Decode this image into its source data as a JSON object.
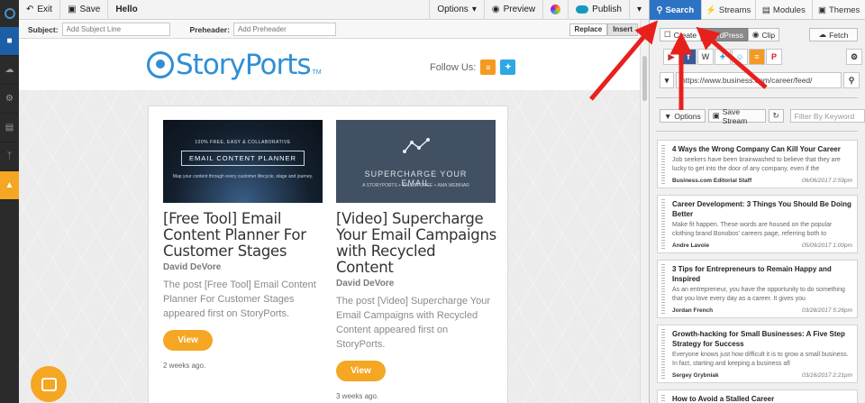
{
  "toolbar": {
    "exit": "Exit",
    "save": "Save",
    "title": "Hello",
    "options": "Options",
    "preview": "Preview",
    "publish": "Publish"
  },
  "subject": {
    "subject_label": "Subject:",
    "subject_placeholder": "Add Subject Line",
    "preheader_label": "Preheader:",
    "preheader_placeholder": "Add Preheader",
    "replace": "Replace",
    "insert": "Insert"
  },
  "email": {
    "brand": "StoryPorts",
    "tm": "TM",
    "follow_us": "Follow Us:",
    "posts": [
      {
        "thumb_top": "100% FREE, EASY & COLLABORATIVE",
        "thumb_title": "EMAIL CONTENT PLANNER",
        "thumb_sub": "Map your content through every customer lifecycle, stage and journey.",
        "title": "[Free Tool] Email Content Planner For Customer Stages",
        "author": "David DeVore",
        "excerpt": "The post [Free Tool] Email Content Planner For Customer Stages appeared first on StoryPorts.",
        "button": "View",
        "ago": "2 weeks ago."
      },
      {
        "thumb_top": "",
        "thumb_title": "SUPERCHARGE YOUR EMAIL",
        "thumb_sub": "A STORYPORTS + SALESFORCE + AMA WEBINAR",
        "title": "[Video] Supercharge Your Email Campaigns with Recycled Content",
        "author": "David DeVore",
        "excerpt": "The post [Video] Supercharge Your Email Campaigns with Recycled Content appeared first on StoryPorts.",
        "button": "View",
        "ago": "3 weeks ago."
      }
    ]
  },
  "rpanel": {
    "tabs": [
      "Search",
      "Streams",
      "Modules",
      "Themes"
    ],
    "create": "Create",
    "wordpress": "WordPress",
    "clip": "Clip",
    "fetch": "Fetch",
    "url": "https://www.business.com/career/feed/",
    "options": "Options",
    "save_stream": "Save Stream",
    "filter_placeholder": "Filter By Keyword"
  },
  "feed": [
    {
      "title": "4 Ways the Wrong Company Can Kill Your Career",
      "desc": "Job seekers have been brainwashed to believe that they are lucky to get into the door of any company, even if the",
      "source": "Business.com Editorial Staff",
      "date": "06/06/2017 2:59pm"
    },
    {
      "title": "Career Development: 3 Things You Should Be Doing Better",
      "desc": "Make fit happen. These words are housed on the popular clothing brand Bonobos' careers page, referring both to",
      "source": "Andre Lavoie",
      "date": "05/09/2017 1:00pm"
    },
    {
      "title": "3 Tips for Entrepreneurs to Remain Happy and Inspired",
      "desc": "As an entrepreneur, you have the opportunity to do something that you love every day as a career. It gives you",
      "source": "Jordan French",
      "date": "03/28/2017 5:26pm"
    },
    {
      "title": "Growth-hacking for Small Businesses: A Five Step Strategy for Success",
      "desc": "Everyone knows just how difficult it is to grow a small business. In fact, starting and keeping a business afl",
      "source": "Sergey Grybniak",
      "date": "03/16/2017 2:21pm"
    },
    {
      "title": "How to Avoid a Stalled Career",
      "desc": "",
      "source": "",
      "date": ""
    }
  ],
  "colors": {
    "accent_blue": "#2c73c4",
    "orange": "#f5a623",
    "arrow_red": "#e8201c"
  }
}
